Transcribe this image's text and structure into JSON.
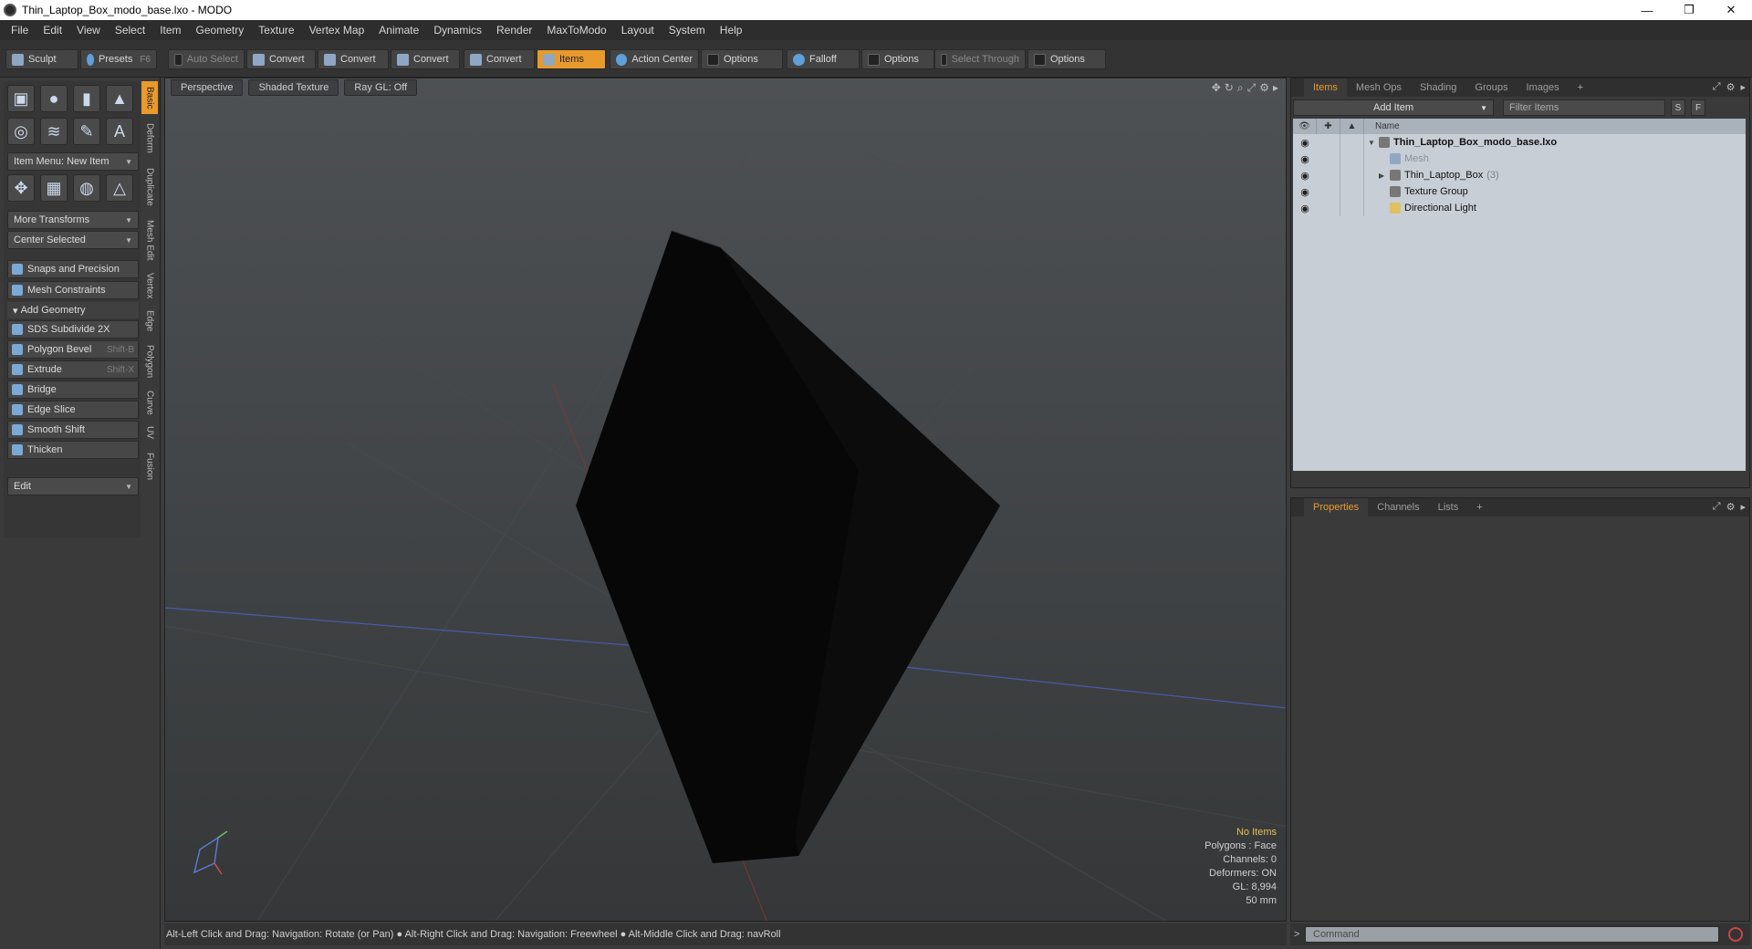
{
  "window": {
    "title": "Thin_Laptop_Box_modo_base.lxo - MODO",
    "buttons": [
      "—",
      "❐",
      "✕"
    ]
  },
  "menu": [
    "File",
    "Edit",
    "View",
    "Select",
    "Item",
    "Geometry",
    "Texture",
    "Vertex Map",
    "Animate",
    "Dynamics",
    "Render",
    "MaxToModo",
    "Layout",
    "System",
    "Help"
  ],
  "toolbar": {
    "sculpt": "Sculpt",
    "presets": "Presets",
    "presets_key": "F6",
    "auto_select": "Auto Select",
    "convert1": "Convert",
    "convert2": "Convert",
    "convert3": "Convert",
    "convert4": "Convert",
    "items": "Items",
    "action_center": "Action Center",
    "options1": "Options",
    "falloff": "Falloff",
    "options2": "Options",
    "select_through": "Select Through",
    "options3": "Options"
  },
  "left": {
    "item_menu": "Item Menu: New Item",
    "more_transforms": "More Transforms",
    "center_selected": "Center Selected",
    "snaps": "Snaps and Precision",
    "mesh_constraints": "Mesh Constraints",
    "add_geometry": "Add Geometry",
    "tools": [
      {
        "label": "SDS Subdivide 2X",
        "shortcut": ""
      },
      {
        "label": "Polygon Bevel",
        "shortcut": "Shift-B"
      },
      {
        "label": "Extrude",
        "shortcut": "Shift-X"
      },
      {
        "label": "Bridge",
        "shortcut": ""
      },
      {
        "label": "Edge Slice",
        "shortcut": ""
      },
      {
        "label": "Smooth Shift",
        "shortcut": ""
      },
      {
        "label": "Thicken",
        "shortcut": ""
      }
    ],
    "edit": "Edit",
    "vtabs": [
      "Basic",
      "Deform",
      "Duplicate",
      "Mesh Edit",
      "Vertex",
      "Edge",
      "Polygon",
      "Curve",
      "UV",
      "Fusion"
    ]
  },
  "viewport": {
    "view": "Perspective",
    "shading": "Shaded Texture",
    "raygl": "Ray GL: Off",
    "info": {
      "no_items": "No Items",
      "polygons": "Polygons : Face",
      "channels": "Channels: 0",
      "deformers": "Deformers: ON",
      "gl": "GL: 8,994",
      "unit": "50 mm"
    }
  },
  "status": "Alt-Left Click and Drag: Navigation: Rotate (or Pan) ● Alt-Right Click and Drag: Navigation: Freewheel ● Alt-Middle Click and Drag: navRoll",
  "items_panel": {
    "tabs": [
      "Items",
      "Mesh Ops",
      "Shading",
      "Groups",
      "Images",
      "+"
    ],
    "add_item": "Add Item",
    "filter": "Filter Items",
    "s_btn": "S",
    "f_btn": "F",
    "name_col": "Name",
    "rows": [
      {
        "label": "Thin_Laptop_Box_modo_base.lxo",
        "count": ""
      },
      {
        "label": "Mesh",
        "count": ""
      },
      {
        "label": "Thin_Laptop_Box",
        "count": "(3)"
      },
      {
        "label": "Texture Group",
        "count": ""
      },
      {
        "label": "Directional Light",
        "count": ""
      }
    ]
  },
  "props_panel": {
    "tabs": [
      "Properties",
      "Channels",
      "Lists",
      "+"
    ]
  },
  "command": {
    "placeholder": "Command",
    "prompt": ">"
  },
  "colors": {
    "accent": "#e89a2a",
    "tree_bg": "#c8ced5"
  }
}
